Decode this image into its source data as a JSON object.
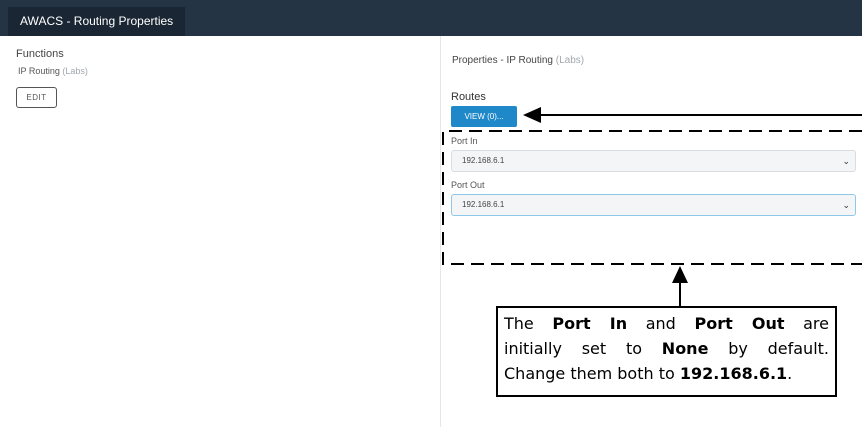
{
  "window": {
    "tab_title": "AWACS - Routing Properties"
  },
  "functions": {
    "title": "Functions",
    "item_name": "IP Routing",
    "item_tag": "(Labs)",
    "edit_label": "EDIT"
  },
  "properties": {
    "title": "Properties  - IP Routing",
    "title_tag": "(Labs)",
    "routes_label": "Routes",
    "view_button": "VIEW (0)...",
    "port_in": {
      "label": "Port In",
      "value": "192.168.6.1"
    },
    "port_out": {
      "label": "Port Out",
      "value": "192.168.6.1"
    }
  },
  "annotation": {
    "line1": {
      "a": "The ",
      "b1": "Port In",
      "c": " and ",
      "b2": "Port Out",
      "d": " are"
    },
    "line2": {
      "a": "initially set to ",
      "b": "None",
      "c": " by default."
    },
    "line3": {
      "a": "Change them both to ",
      "b": "192.168.6.1",
      "c": "."
    }
  },
  "icons": {
    "dropdown": "chevron-down-icon",
    "arrow": "arrow-icon"
  }
}
